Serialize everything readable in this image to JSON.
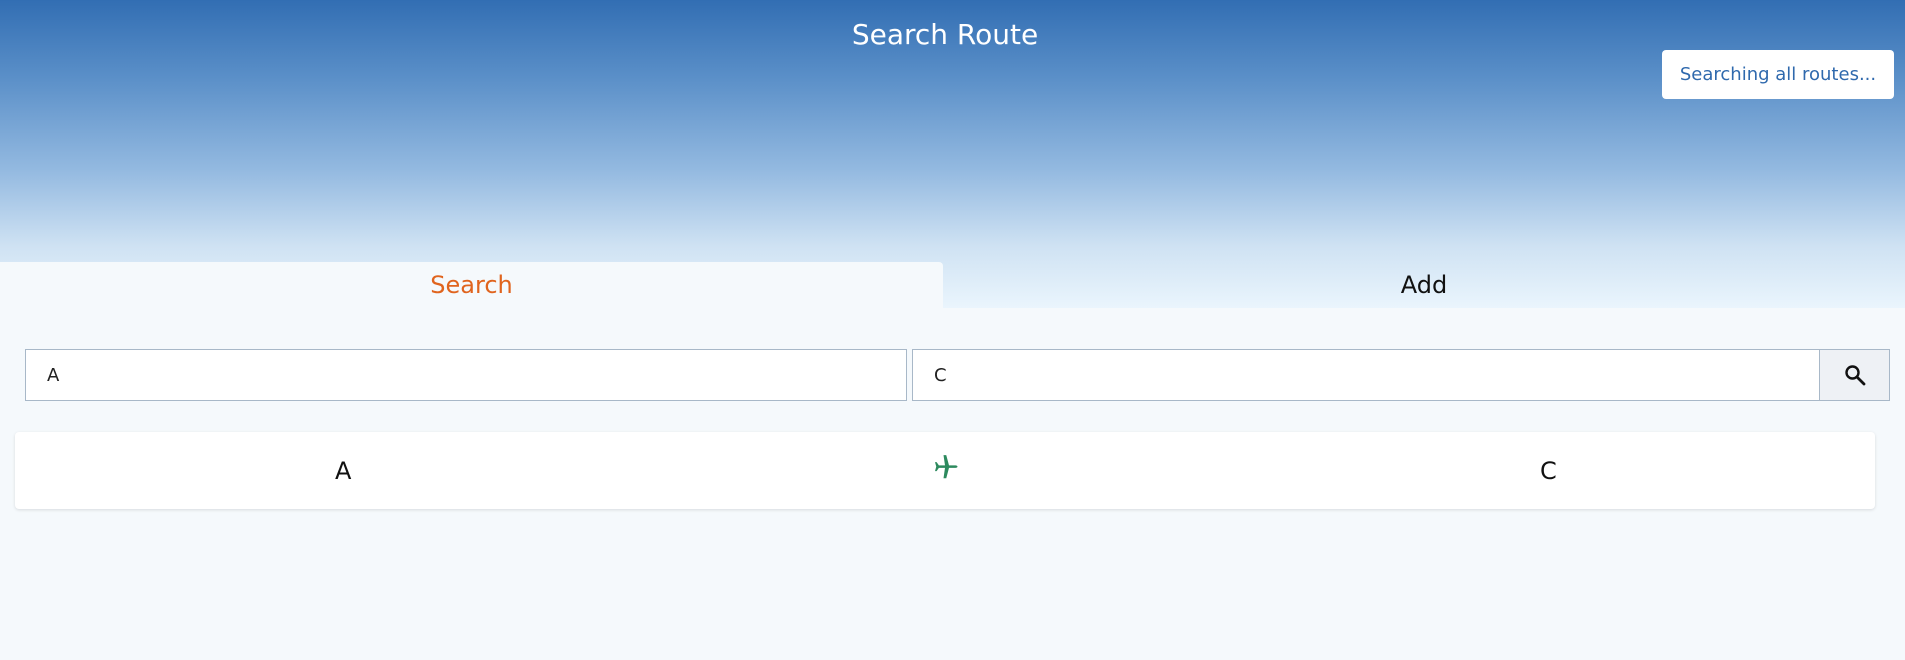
{
  "header": {
    "title": "Search Route",
    "status": "Searching all routes..."
  },
  "tabs": [
    {
      "label": "Search",
      "active": true
    },
    {
      "label": "Add",
      "active": false
    }
  ],
  "search": {
    "from_value": "A",
    "to_value": "C",
    "button_icon": "search-icon"
  },
  "result": {
    "from": "A",
    "to": "C",
    "icon": "airplane-icon"
  },
  "colors": {
    "accent_tab": "#e0641e",
    "plane": "#2d8a5e",
    "brand_blue": "#2f69ad"
  }
}
